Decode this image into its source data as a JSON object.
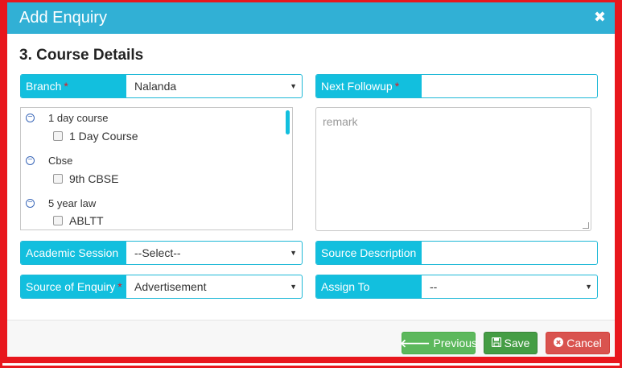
{
  "modal": {
    "title": "Add Enquiry",
    "close_icon": "✖"
  },
  "section": {
    "title": "3. Course Details"
  },
  "fields": {
    "branch": {
      "label": "Branch",
      "required": "*",
      "value": "Nalanda"
    },
    "next_followup": {
      "label": "Next Followup",
      "required": "*",
      "value": ""
    },
    "academic_session": {
      "label": "Academic Session",
      "value": "--Select--"
    },
    "source_description": {
      "label": "Source Description",
      "value": ""
    },
    "source_of_enquiry": {
      "label": "Source of Enquiry",
      "required": "*",
      "value": "Advertisement"
    },
    "assign_to": {
      "label": "Assign To",
      "value": "--"
    }
  },
  "remark": {
    "placeholder": "remark"
  },
  "course_tree": [
    {
      "group": "1 day course",
      "items": [
        "1 Day Course"
      ]
    },
    {
      "group": "Cbse",
      "items": [
        "9th CBSE"
      ]
    },
    {
      "group": "5 year law",
      "items": [
        "ABLTT"
      ]
    }
  ],
  "icons": {
    "collapse": "minus-circle-icon",
    "dropdown": "caret-down-icon",
    "previous": "arrow-left-icon",
    "save": "floppy-disk-icon",
    "cancel": "x-circle-icon"
  },
  "buttons": {
    "previous": "Previous",
    "save": "Save",
    "cancel": "Cancel"
  },
  "colors": {
    "header": "#31b0d5",
    "label_bg": "#12bfde",
    "frame": "#e8171d",
    "previous": "#5cb85c",
    "save": "#449d44",
    "cancel": "#d9534f"
  }
}
